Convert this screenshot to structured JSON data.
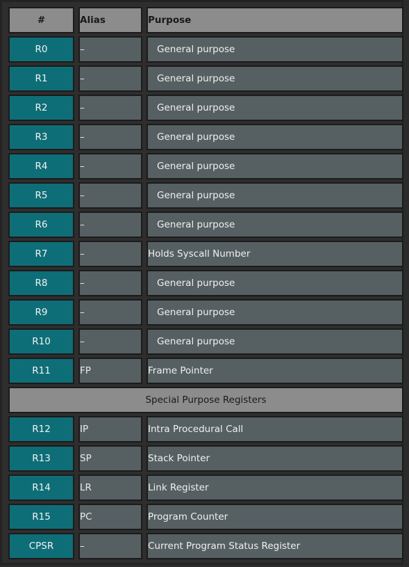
{
  "table": {
    "columns": [
      {
        "key": "num",
        "label": "#"
      },
      {
        "key": "alias",
        "label": "Alias"
      },
      {
        "key": "purpose",
        "label": "Purpose"
      }
    ],
    "section_label": "Special Purpose Registers",
    "dash": "–",
    "rows": [
      {
        "num": "R0",
        "alias": "–",
        "purpose": "General purpose"
      },
      {
        "num": "R1",
        "alias": "–",
        "purpose": "General purpose"
      },
      {
        "num": "R2",
        "alias": "–",
        "purpose": "General purpose"
      },
      {
        "num": "R3",
        "alias": "–",
        "purpose": "General purpose"
      },
      {
        "num": "R4",
        "alias": "–",
        "purpose": "General purpose"
      },
      {
        "num": "R5",
        "alias": "–",
        "purpose": "General purpose"
      },
      {
        "num": "R6",
        "alias": "–",
        "purpose": "General purpose"
      },
      {
        "num": "R7",
        "alias": "–",
        "purpose": "Holds Syscall Number"
      },
      {
        "num": "R8",
        "alias": "–",
        "purpose": "General purpose"
      },
      {
        "num": "R9",
        "alias": "–",
        "purpose": "General purpose"
      },
      {
        "num": "R10",
        "alias": "–",
        "purpose": "General purpose"
      },
      {
        "num": "R11",
        "alias": "FP",
        "purpose": "Frame Pointer"
      },
      {
        "num": "R12",
        "alias": "IP",
        "purpose": "Intra Procedural Call"
      },
      {
        "num": "R13",
        "alias": "SP",
        "purpose": "Stack Pointer"
      },
      {
        "num": "R14",
        "alias": "LR",
        "purpose": "Link Register"
      },
      {
        "num": "R15",
        "alias": "PC",
        "purpose": "Program Counter"
      },
      {
        "num": "CPSR",
        "alias": "–",
        "purpose": "Current Program Status Register"
      }
    ],
    "section_after_row_index": 11,
    "indented_purposes": [
      "General purpose"
    ]
  },
  "colors": {
    "page_background": "#2b2b2b",
    "table_background": "#2e2e2e",
    "header_gray": "#8c8c8c",
    "register_teal": "#0e6e78",
    "cell_slate": "#566063",
    "cell_border": "#1b1b1b",
    "frame_border": "#232323",
    "header_text": "#1a1a1a",
    "cell_text": "#f0f0f0"
  }
}
